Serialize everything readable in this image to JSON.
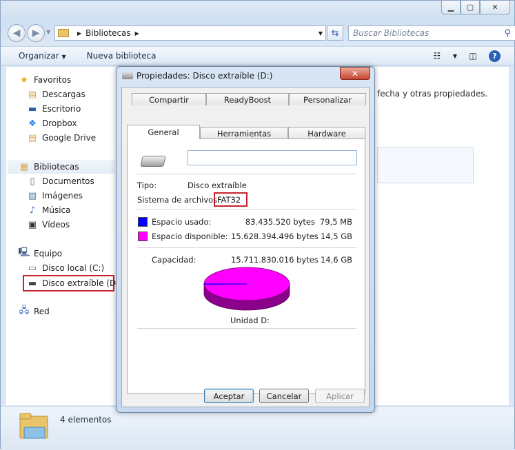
{
  "address": {
    "path": "Bibliotecas"
  },
  "search": {
    "placeholder": "Buscar Bibliotecas"
  },
  "toolbar": {
    "organize": "Organizar",
    "new_library": "Nueva biblioteca"
  },
  "nav": {
    "favorites": "Favoritos",
    "favorites_items": [
      "Descargas",
      "Escritorio",
      "Dropbox",
      "Google Drive"
    ],
    "libraries": "Bibliotecas",
    "libraries_items": [
      "Documentos",
      "Imágenes",
      "Música",
      "Vídeos"
    ],
    "computer": "Equipo",
    "computer_items": [
      "Disco local (C:)",
      "Disco extraíble (D:)"
    ],
    "network": "Red"
  },
  "content": {
    "partial_text": "fecha y otras propiedades."
  },
  "status": {
    "count": "4 elementos"
  },
  "dialog": {
    "title": "Propiedades: Disco extraíble (D:)",
    "tabs_row1": [
      "Compartir",
      "ReadyBoost",
      "Personalizar"
    ],
    "tabs_row2": [
      "General",
      "Herramientas",
      "Hardware"
    ],
    "type_label": "Tipo:",
    "type_value": "Disco extraíble",
    "fs_label": "Sistema de archivos:",
    "fs_value": "FAT32",
    "used_label": "Espacio usado:",
    "used_bytes": "83.435.520 bytes",
    "used_size": "79,5 MB",
    "free_label": "Espacio disponible:",
    "free_bytes": "15.628.394.496 bytes",
    "free_size": "14,5 GB",
    "capacity_label": "Capacidad:",
    "capacity_bytes": "15.711.830.016 bytes",
    "capacity_size": "14,6 GB",
    "drive_label": "Unidad D:",
    "ok": "Aceptar",
    "cancel": "Cancelar",
    "apply": "Aplicar"
  },
  "colors": {
    "used": "#0000ff",
    "free": "#ff00ff",
    "highlight": "#c8232c"
  },
  "disk_usage": {
    "used_bytes": 83435520,
    "free_bytes": 15628394496
  }
}
